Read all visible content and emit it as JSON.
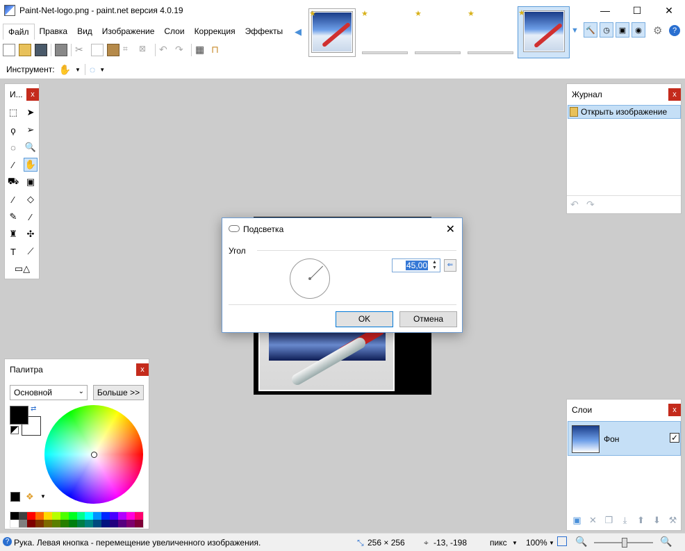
{
  "window": {
    "title": "Paint-Net-logo.png - paint.net версия 4.0.19",
    "minimize": "—",
    "maximize": "☐",
    "close": "✕"
  },
  "menu": [
    "Файл",
    "Правка",
    "Вид",
    "Изображение",
    "Слои",
    "Коррекция",
    "Эффекты"
  ],
  "toolbar": {
    "tool_label": "Инструмент:"
  },
  "tools_panel": {
    "title": "И...",
    "close": "x"
  },
  "history_panel": {
    "title": "Журнал",
    "close": "x",
    "items": [
      "Открыть изображение"
    ]
  },
  "layers_panel": {
    "title": "Слои",
    "close": "x",
    "layers": [
      {
        "name": "Фон",
        "visible": "✓"
      }
    ]
  },
  "palette_panel": {
    "title": "Палитра",
    "close": "x",
    "mode": "Основной",
    "more_button": "Больше >>",
    "primary_color": "#000000",
    "secondary_color": "#ffffff",
    "swatches": [
      "#000000",
      "#404040",
      "#ff0000",
      "#ff6a00",
      "#ffd800",
      "#b6ff00",
      "#4cff00",
      "#00ff21",
      "#00ff90",
      "#00ffff",
      "#0094ff",
      "#0026ff",
      "#4800ff",
      "#b200ff",
      "#ff00dc",
      "#ff006e",
      "#ffffff",
      "#808080",
      "#7f0000",
      "#7f3300",
      "#7f6a00",
      "#5b7f00",
      "#267f00",
      "#007f0e",
      "#007f46",
      "#007f7f",
      "#004a7f",
      "#00137f",
      "#21007f",
      "#57007f",
      "#7f006e",
      "#7f0037"
    ]
  },
  "dialog": {
    "title": "Подсветка",
    "close": "✕",
    "group_label": "Угол",
    "angle_value": "45,00",
    "reset_icon": "⇐",
    "ok": "OK",
    "cancel": "Отмена"
  },
  "statusbar": {
    "hint": "Рука. Левая кнопка - перемещение увеличенного изображения.",
    "size": "256 × 256",
    "cursor": "-13, -198",
    "units": "пикс",
    "zoom": "100%"
  },
  "colors": {
    "accent": "#0078d7",
    "close_red": "#c42b1c",
    "workspace": "#cccccc",
    "selection": "#c5dff6"
  }
}
